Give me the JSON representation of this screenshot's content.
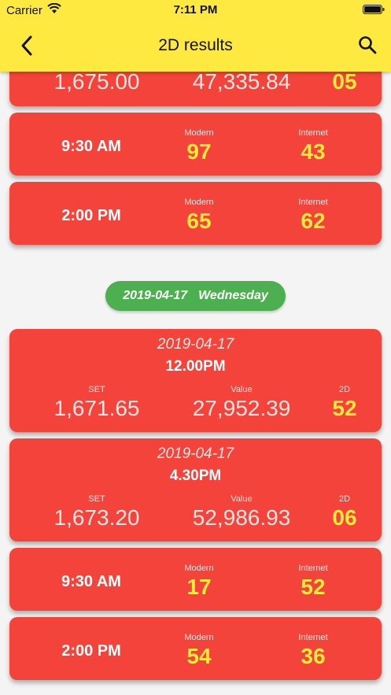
{
  "status_bar": {
    "carrier": "Carrier",
    "time": "7:11 PM"
  },
  "nav": {
    "title": "2D results",
    "back_icon": "chevron-left-icon",
    "search_icon": "search-icon"
  },
  "partial_card": {
    "set": "1,675.00",
    "value": "47,335.84",
    "twod": "05"
  },
  "group1_times": [
    {
      "time": "9:30 AM",
      "modern_label": "Modern",
      "modern": "97",
      "internet_label": "Internet",
      "internet": "43"
    },
    {
      "time": "2:00 PM",
      "modern_label": "Modern",
      "modern": "65",
      "internet_label": "Internet",
      "internet": "62"
    }
  ],
  "date_header": {
    "date": "2019-04-17",
    "day": "Wednesday"
  },
  "results": [
    {
      "date": "2019-04-17",
      "session": "12.00PM",
      "set_label": "SET",
      "set": "1,671.65",
      "value_label": "Value",
      "value": "27,952.39",
      "twod_label": "2D",
      "twod": "52"
    },
    {
      "date": "2019-04-17",
      "session": "4.30PM",
      "set_label": "SET",
      "set": "1,673.20",
      "value_label": "Value",
      "value": "52,986.93",
      "twod_label": "2D",
      "twod": "06"
    }
  ],
  "group2_times": [
    {
      "time": "9:30 AM",
      "modern_label": "Modern",
      "modern": "17",
      "internet_label": "Internet",
      "internet": "52"
    },
    {
      "time": "2:00 PM",
      "modern_label": "Modern",
      "modern": "54",
      "internet_label": "Internet",
      "internet": "36"
    }
  ],
  "colors": {
    "appbar": "#fde93f",
    "card": "#f3433a",
    "number_yellow": "#ffea3b",
    "chip_green": "#4caf50"
  }
}
